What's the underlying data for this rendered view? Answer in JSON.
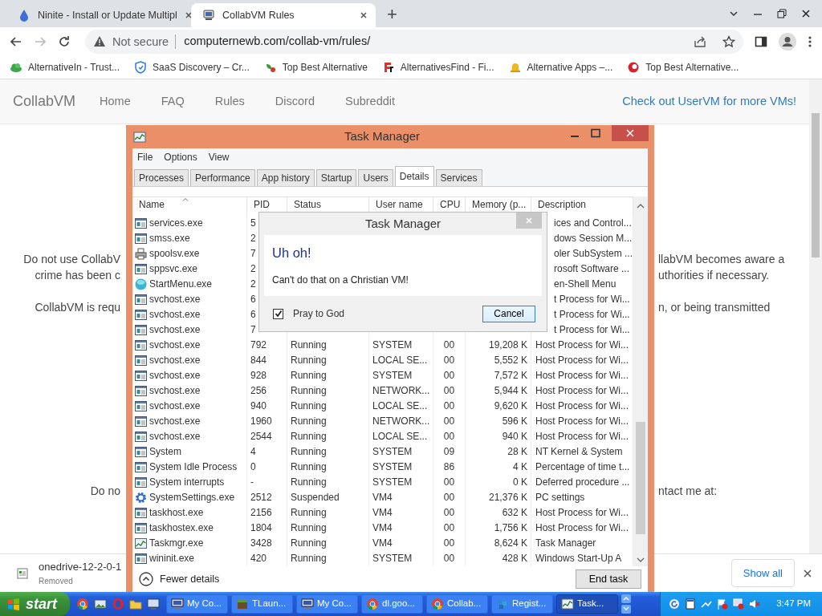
{
  "browser": {
    "tabs": [
      {
        "title": "Ninite - Install or Update Multipl",
        "selected": false
      },
      {
        "title": "CollabVM Rules",
        "selected": true
      }
    ],
    "new_tab": "+",
    "address": {
      "security": "Not secure",
      "url": "computernewb.com/collab-vm/rules/"
    },
    "bookmarks": [
      {
        "label": "AlternativeIn - Trust..."
      },
      {
        "label": "SaaS Discovery – Cr..."
      },
      {
        "label": "Top Best Alternative"
      },
      {
        "label": "AlternativesFind - Fi..."
      },
      {
        "label": "Alternative Apps –..."
      },
      {
        "label": "Top Best Alternative..."
      }
    ]
  },
  "site": {
    "brand": "CollabVM",
    "nav": [
      {
        "label": "Home"
      },
      {
        "label": "FAQ"
      },
      {
        "label": "Rules"
      },
      {
        "label": "Discord"
      },
      {
        "label": "Subreddit"
      }
    ],
    "promo": "Check out UserVM for more VMs!",
    "lines": [
      {
        "left": "Do not use CollabV",
        "right": "llabVM becomes aware a"
      },
      {
        "left": "crime has been c",
        "right": "uthorities if necessary."
      },
      {
        "left": "CollabVM is requ",
        "right": "n, or being transmitted"
      },
      {
        "left": "Do no",
        "right": "ntact me at:"
      }
    ]
  },
  "task_manager": {
    "title": "Task Manager",
    "menu": [
      "File",
      "Options",
      "View"
    ],
    "tabs": [
      {
        "label": "Processes",
        "selected": false
      },
      {
        "label": "Performance",
        "selected": false
      },
      {
        "label": "App history",
        "selected": false
      },
      {
        "label": "Startup",
        "selected": false
      },
      {
        "label": "Users",
        "selected": false
      },
      {
        "label": "Details",
        "selected": true
      },
      {
        "label": "Services",
        "selected": false
      }
    ],
    "columns": [
      "Name",
      "PID",
      "Status",
      "User name",
      "CPU",
      "Memory (p...",
      "Description"
    ],
    "rows": [
      {
        "kind": "program",
        "name": "services.exe",
        "pid": "5",
        "description": "ices and Control..."
      },
      {
        "kind": "program",
        "name": "smss.exe",
        "pid": "2",
        "description": "dows Session M..."
      },
      {
        "kind": "printer",
        "name": "spoolsv.exe",
        "pid": "7",
        "description": "oler SubSystem ..."
      },
      {
        "kind": "program",
        "name": "sppsvc.exe",
        "pid": "2",
        "description": "rosoft Software ..."
      },
      {
        "kind": "globe",
        "name": "StartMenu.exe",
        "pid": "2",
        "description": "en-Shell Menu"
      },
      {
        "kind": "program",
        "name": "svchost.exe",
        "pid": "6",
        "description": "t Process for Wi..."
      },
      {
        "kind": "program",
        "name": "svchost.exe",
        "pid": "6",
        "description": "t Process for Wi..."
      },
      {
        "kind": "program",
        "name": "svchost.exe",
        "pid": "7",
        "description": "t Process for Wi..."
      },
      {
        "kind": "program",
        "name": "svchost.exe",
        "pid": "792",
        "status": "Running",
        "user": "SYSTEM",
        "cpu": "00",
        "memory": "19,208 K",
        "description": "Host Process for Wi..."
      },
      {
        "kind": "program",
        "name": "svchost.exe",
        "pid": "844",
        "status": "Running",
        "user": "LOCAL SE...",
        "cpu": "00",
        "memory": "5,552 K",
        "description": "Host Process for Wi..."
      },
      {
        "kind": "program",
        "name": "svchost.exe",
        "pid": "928",
        "status": "Running",
        "user": "SYSTEM",
        "cpu": "00",
        "memory": "7,572 K",
        "description": "Host Process for Wi..."
      },
      {
        "kind": "program",
        "name": "svchost.exe",
        "pid": "256",
        "status": "Running",
        "user": "NETWORK...",
        "cpu": "00",
        "memory": "5,944 K",
        "description": "Host Process for Wi..."
      },
      {
        "kind": "program",
        "name": "svchost.exe",
        "pid": "940",
        "status": "Running",
        "user": "LOCAL SE...",
        "cpu": "00",
        "memory": "9,620 K",
        "description": "Host Process for Wi..."
      },
      {
        "kind": "program",
        "name": "svchost.exe",
        "pid": "1960",
        "status": "Running",
        "user": "NETWORK...",
        "cpu": "00",
        "memory": "596 K",
        "description": "Host Process for Wi..."
      },
      {
        "kind": "program",
        "name": "svchost.exe",
        "pid": "2544",
        "status": "Running",
        "user": "LOCAL SE...",
        "cpu": "00",
        "memory": "940 K",
        "description": "Host Process for Wi..."
      },
      {
        "kind": "program",
        "name": "System",
        "pid": "4",
        "status": "Running",
        "user": "SYSTEM",
        "cpu": "09",
        "memory": "28 K",
        "description": "NT Kernel & System"
      },
      {
        "kind": "program",
        "name": "System Idle Process",
        "pid": "0",
        "status": "Running",
        "user": "SYSTEM",
        "cpu": "86",
        "memory": "4 K",
        "description": "Percentage of time t..."
      },
      {
        "kind": "program",
        "name": "System interrupts",
        "pid": "-",
        "status": "Running",
        "user": "SYSTEM",
        "cpu": "00",
        "memory": "0 K",
        "description": "Deferred procedure ..."
      },
      {
        "kind": "gear",
        "name": "SystemSettings.exe",
        "pid": "2512",
        "status": "Suspended",
        "user": "VM4",
        "cpu": "00",
        "memory": "21,376 K",
        "description": "PC settings"
      },
      {
        "kind": "program",
        "name": "taskhost.exe",
        "pid": "2156",
        "status": "Running",
        "user": "VM4",
        "cpu": "00",
        "memory": "632 K",
        "description": "Host Process for Wi..."
      },
      {
        "kind": "program",
        "name": "taskhostex.exe",
        "pid": "1804",
        "status": "Running",
        "user": "VM4",
        "cpu": "00",
        "memory": "1,756 K",
        "description": "Host Process for Wi..."
      },
      {
        "kind": "chart",
        "name": "Taskmgr.exe",
        "pid": "3428",
        "status": "Running",
        "user": "VM4",
        "cpu": "00",
        "memory": "8,624 K",
        "description": "Task Manager"
      },
      {
        "kind": "program",
        "name": "wininit.exe",
        "pid": "420",
        "status": "Running",
        "user": "SYSTEM",
        "cpu": "00",
        "memory": "428 K",
        "description": "Windows Start-Up A"
      }
    ],
    "fewer_details": "Fewer details",
    "end_task": "End task"
  },
  "dialog": {
    "title": "Task Manager",
    "heading": "Uh oh!",
    "message": "Can't do that on a Christian VM!",
    "checkbox": {
      "label": "Pray to God",
      "checked": true
    },
    "button": "Cancel"
  },
  "downloads": {
    "file": "onedrive-12-2-0-1",
    "status": "Removed",
    "show_all": "Show all"
  },
  "taskbar": {
    "start": "start",
    "tasks": [
      {
        "label": "My Co...",
        "selected": false
      },
      {
        "label": "TLaun...",
        "selected": false
      },
      {
        "label": "My Co...",
        "selected": false
      },
      {
        "label": "dl.goo...",
        "selected": false
      },
      {
        "label": "Collab...",
        "selected": false
      },
      {
        "label": "Regist...",
        "selected": false
      },
      {
        "label": "Task...",
        "selected": true
      }
    ],
    "clock": "3:47 PM"
  }
}
